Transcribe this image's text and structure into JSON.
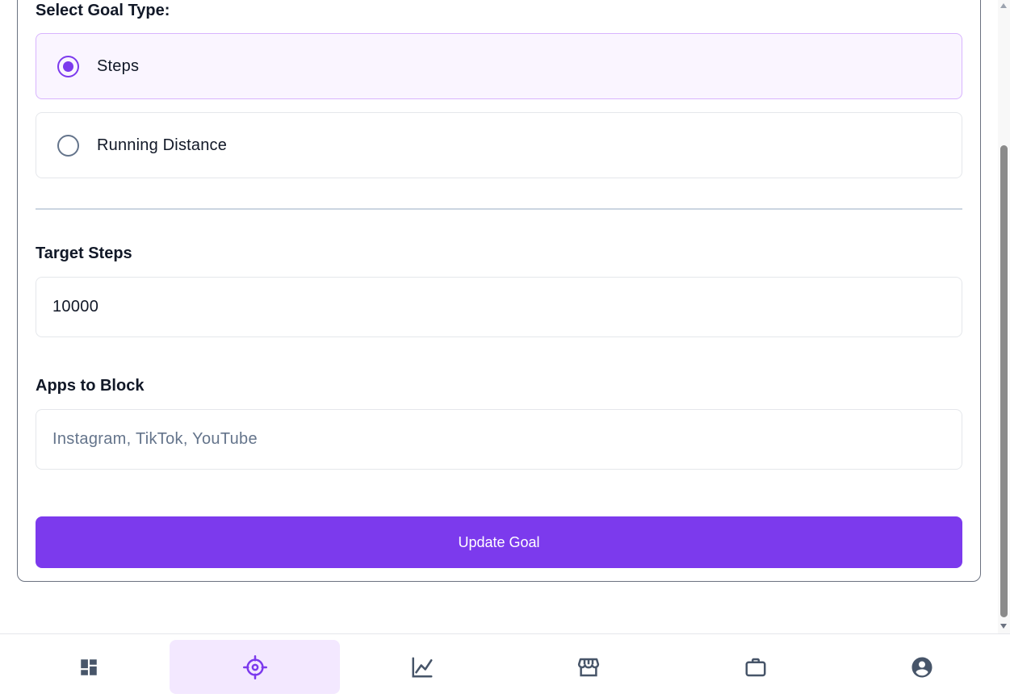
{
  "form": {
    "goal_type_title": "Select Goal Type:",
    "options": [
      {
        "label": "Steps",
        "selected": true
      },
      {
        "label": "Running Distance",
        "selected": false
      }
    ],
    "target_label": "Target Steps",
    "target_value": "10000",
    "apps_label": "Apps to Block",
    "apps_placeholder": "Instagram, TikTok, YouTube",
    "apps_value": "",
    "submit_label": "Update Goal"
  },
  "nav": {
    "items": [
      {
        "icon": "dashboard-icon",
        "active": false
      },
      {
        "icon": "target-icon",
        "active": true
      },
      {
        "icon": "chart-line-icon",
        "active": false
      },
      {
        "icon": "store-icon",
        "active": false
      },
      {
        "icon": "briefcase-icon",
        "active": false
      },
      {
        "icon": "account-circle-icon",
        "active": false
      }
    ]
  },
  "colors": {
    "accent": "#7c3aed",
    "selected_bg": "#faf5ff",
    "nav_active_bg": "#f3e8ff",
    "icon_gray": "#475569"
  }
}
